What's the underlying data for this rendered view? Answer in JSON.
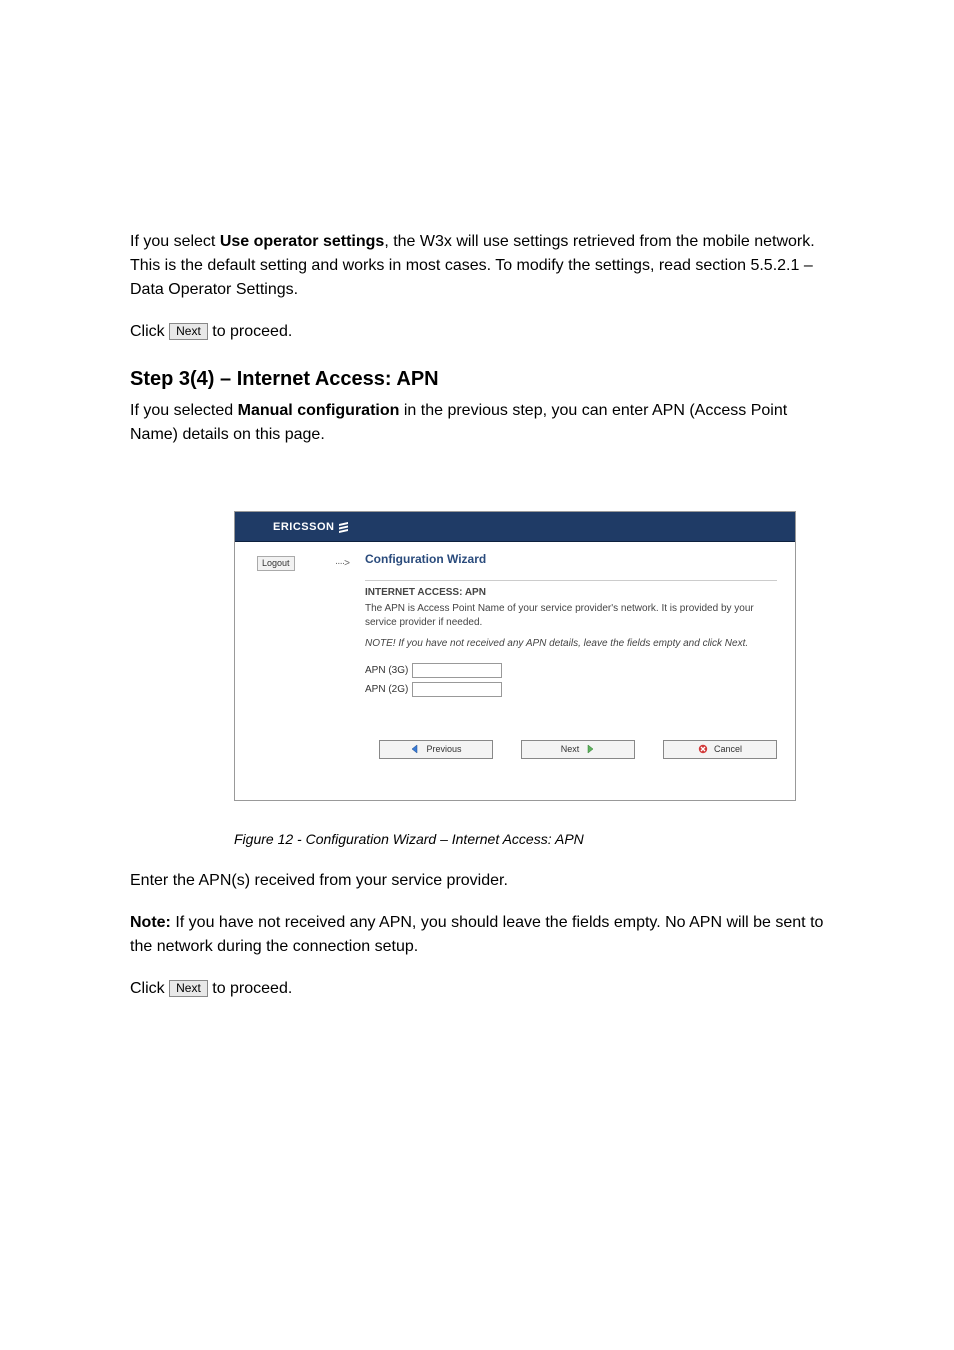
{
  "doc": {
    "para1_pre": "If you select ",
    "para1_bold": "Use operator settings",
    "para1_post": ", the W3x will use settings retrieved from the mobile network. This is the default setting and works in most cases. To modify the settings, read section ",
    "para1_link": "5.5.2.1",
    "para1_after": " – ",
    "para1_title": "Data Operator Settings.",
    "para2_pre": "Click ",
    "para2_btn": "Next",
    "para2_post": " to proceed."
  },
  "section": {
    "heading": "Step 3(4) – Internet Access: APN",
    "intro_pre": "If you selected ",
    "intro_bold": "Manual configuration",
    "intro_post": " in the previous step, you can enter APN (Access Point Name) details on this page."
  },
  "router": {
    "brand": "ERICSSON",
    "logout": "Logout",
    "sidebarDots": "····>",
    "wizardTitle": "Configuration Wizard",
    "sectionTitle": "INTERNET ACCESS: APN",
    "desc": "The APN is Access Point Name of your service provider's network. It is provided by your service provider if needed.",
    "note": "NOTE! If you have not received any APN details, leave the fields empty and click Next.",
    "apn3gLabel": "APN (3G)",
    "apn2gLabel": "APN (2G)",
    "prevBtn": "Previous",
    "nextBtn": "Next",
    "cancelBtn": "Cancel"
  },
  "caption": "Figure 12 - Configuration Wizard – Internet Access: APN",
  "afterFigure": {
    "para1": "Enter the APN(s) received from your service provider.",
    "note_label": "Note:",
    "note_body": "If you have not received any APN, you should leave the fields empty. No APN will be sent to the network during the connection setup.",
    "para2_pre": "Click ",
    "para2_btn": "Next",
    "para2_post": " to proceed."
  }
}
